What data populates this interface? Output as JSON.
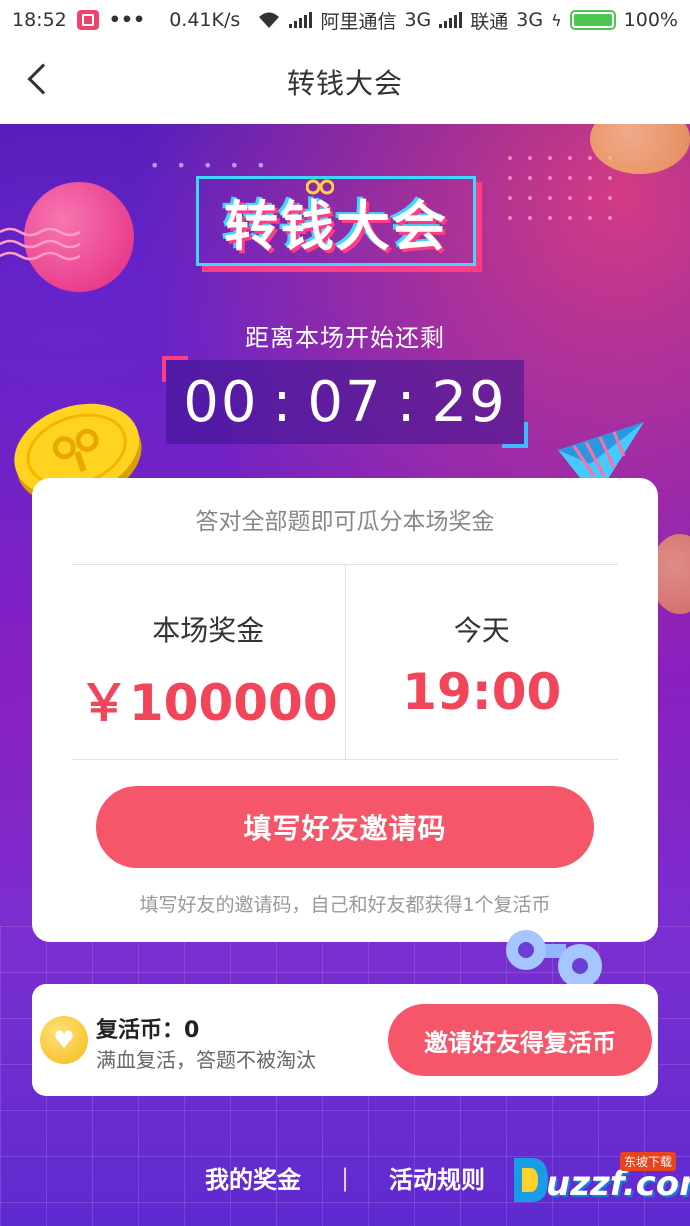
{
  "status_bar": {
    "time": "18:52",
    "more": "•••",
    "speed": "0.41K/s",
    "carrier1": "阿里通信",
    "net1": "3G",
    "carrier2": "联通",
    "net2": "3G",
    "battery": "100%",
    "battery_level": 1.0
  },
  "nav": {
    "title": "转钱大会",
    "back_icon": "chevron-left-icon"
  },
  "hero": {
    "logo_text": "转钱大会",
    "countdown_label": "距离本场开始还剩",
    "countdown": {
      "hours": "00",
      "minutes": "07",
      "seconds": "29",
      "separator": ":"
    }
  },
  "card": {
    "subtitle": "答对全部题即可瓜分本场奖金",
    "prize_label": "本场奖金",
    "prize_value": "￥100000",
    "time_label": "今天",
    "time_value": "19:00",
    "fill_button": "填写好友邀请码",
    "note": "填写好友的邀请码，自己和好友都获得1个复活币"
  },
  "revive": {
    "title": "复活币：0",
    "desc": "满血复活，答题不被淘汰",
    "invite_button": "邀请好友得复活币",
    "icon": "heart-coin-icon"
  },
  "bottom": {
    "my_prize": "我的奖金",
    "divider": "|",
    "rules": "活动规则"
  },
  "watermark": {
    "brand": "uzzf.com",
    "tag": "东坡下载"
  },
  "colors": {
    "accent": "#f5566a",
    "value_red": "#f2455a",
    "cyan": "#40d6ff",
    "pink": "#ff3d87"
  }
}
